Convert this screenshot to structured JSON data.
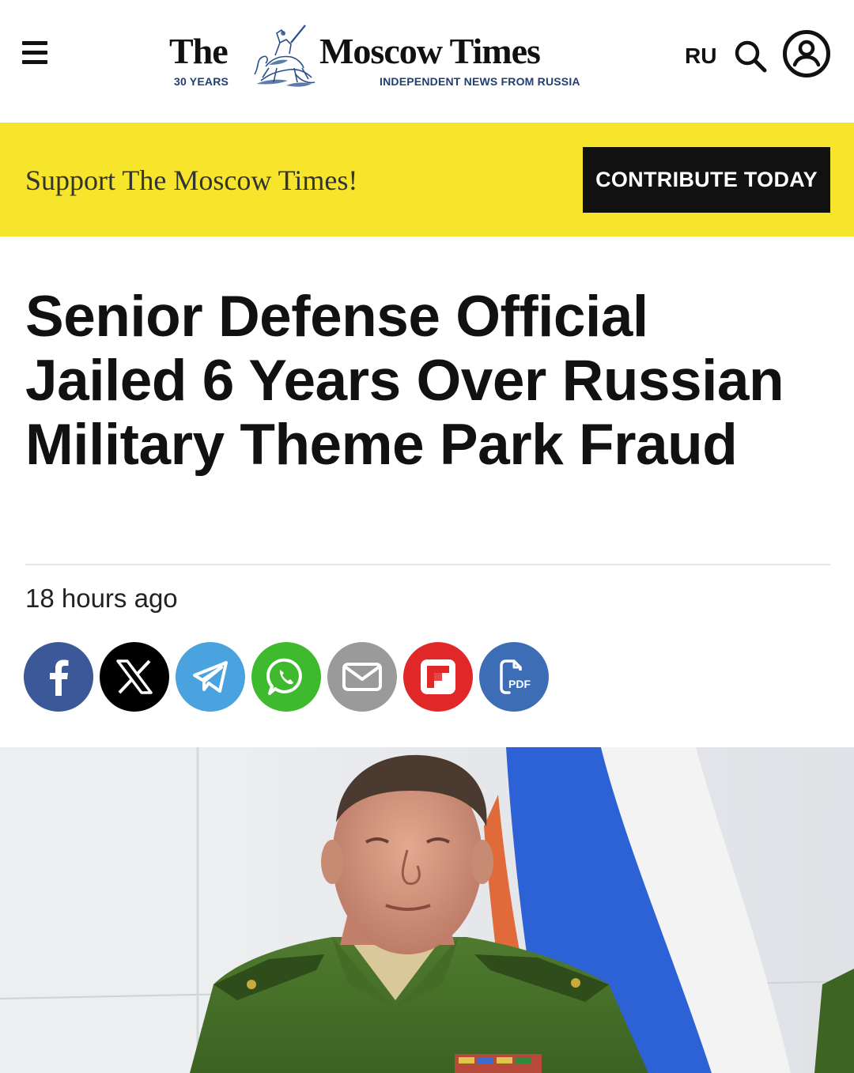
{
  "header": {
    "logo_the": "The",
    "logo_years": "30 YEARS",
    "logo_name": "Moscow Times",
    "logo_tagline": "INDEPENDENT NEWS FROM RUSSIA",
    "lang_label": "RU",
    "icons": [
      "menu-icon",
      "search-icon",
      "account-icon"
    ]
  },
  "support": {
    "text": "Support The Moscow Times!",
    "button_label": "CONTRIBUTE TODAY",
    "background_color": "#f6e52a"
  },
  "article": {
    "headline": "Senior Defense Official Jailed 6 Years Over Russian Military Theme Park Fraud",
    "timestamp": "18 hours ago"
  },
  "share": [
    {
      "name": "facebook",
      "icon": "facebook-icon",
      "color": "#3b5998"
    },
    {
      "name": "x",
      "icon": "x-icon",
      "color": "#000000"
    },
    {
      "name": "telegram",
      "icon": "telegram-icon",
      "color": "#4aa3df"
    },
    {
      "name": "whatsapp",
      "icon": "whatsapp-icon",
      "color": "#3fba2e"
    },
    {
      "name": "email",
      "icon": "email-icon",
      "color": "#9a9a9a"
    },
    {
      "name": "flipboard",
      "icon": "flipboard-icon",
      "color": "#e12828"
    },
    {
      "name": "pdf",
      "icon": "pdf-icon",
      "color": "#3d6db4",
      "label": "PDF"
    }
  ]
}
